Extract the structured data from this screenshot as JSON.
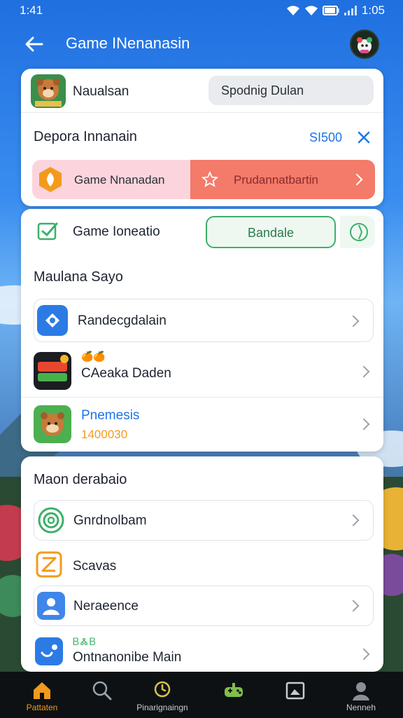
{
  "status_bar": {
    "time": "1:41",
    "clock_right": "1:05"
  },
  "app_bar": {
    "title": "Game INenanasin",
    "avatar_icon": "mascot-avatar-icon"
  },
  "card1": {
    "user_name": "Naualsan",
    "user_button": "Spodnig Dulan",
    "deposit_title": "Depora Innanain",
    "deposit_amount": "SI500",
    "promo_left": "Game Nnanadan",
    "promo_right": "Prudannatbartin"
  },
  "card2": {
    "game_location_label": "Game Ioneatio",
    "bundle_button": "Bandale",
    "section_title": "Maulana Sayo",
    "items": [
      {
        "label": "Randecgdalain"
      },
      {
        "label": "CAeaka Daden",
        "badge": "🍊🍊"
      },
      {
        "label": "Pnemesis",
        "sublabel": "1400030"
      }
    ]
  },
  "card3": {
    "section_title": "Maon derabaio",
    "items": [
      {
        "label": "Gnrdnolbam"
      },
      {
        "label": "Scavas"
      },
      {
        "label": "Neraeence"
      },
      {
        "label": "Ontnanonibe Main",
        "badge": "ᏴᏜᏴ"
      }
    ]
  },
  "bottom_nav": [
    {
      "label": "Pattaten",
      "icon": "home-icon",
      "active": true
    },
    {
      "label": "",
      "icon": "search-icon"
    },
    {
      "label": "Pinarignaingn",
      "icon": "clock-icon"
    },
    {
      "label": "",
      "icon": "controller-icon"
    },
    {
      "label": "",
      "icon": "gallery-icon"
    },
    {
      "label": "Nenneh",
      "icon": "profile-icon"
    }
  ],
  "colors": {
    "accent_blue": "#1e74e6",
    "promo_red": "#f47a6a",
    "promo_pink": "#fcd4dd",
    "green": "#3cb06a",
    "orange": "#f39a1c"
  }
}
